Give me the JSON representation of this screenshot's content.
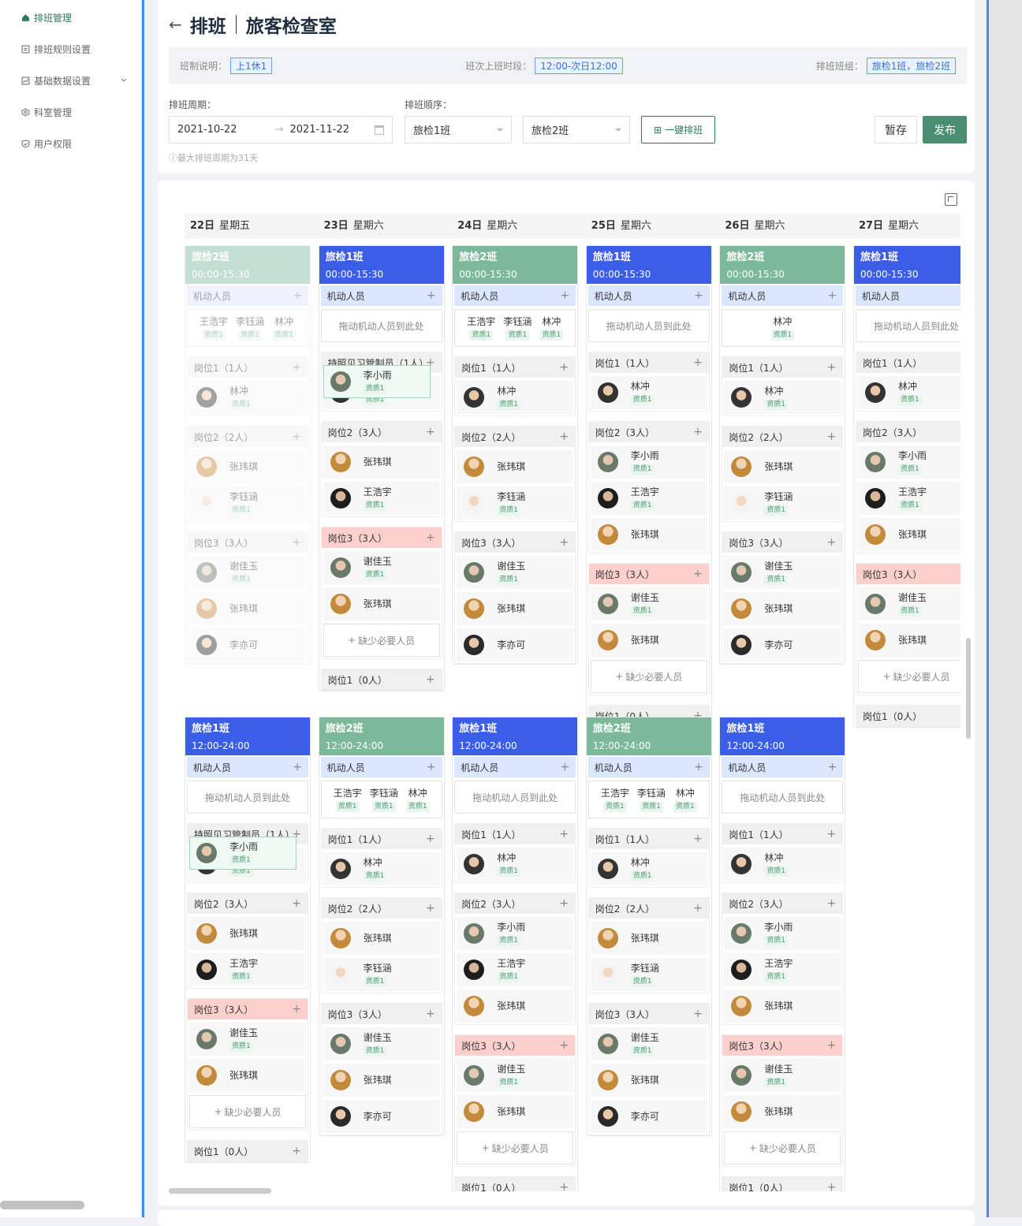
{
  "sidebar": {
    "items": [
      {
        "label": "排班管理",
        "icon": "home-icon",
        "active": true
      },
      {
        "label": "排班规则设置",
        "icon": "document-icon"
      },
      {
        "label": "基础数据设置",
        "icon": "chart-icon",
        "chevron": true
      },
      {
        "label": "科室管理",
        "icon": "settings-icon"
      },
      {
        "label": "用户权限",
        "icon": "shield-icon"
      }
    ]
  },
  "header": {
    "back_icon": "←",
    "title": "排班",
    "subtitle": "旅客检查室",
    "info": {
      "system_label": "班制说明：",
      "system_value": "上1休1",
      "period_label": "班次上班时段：",
      "period_value": "12:00-次日12:00",
      "group_label": "排班班组：",
      "group_value": "旅检1班，旅检2班"
    },
    "cycle_label": "排班周期：",
    "start_date": "2021-10-22",
    "end_date": "2021-11-22",
    "order_label": "排班顺序：",
    "order1": "旅检1班",
    "order2": "旅检2班",
    "auto_button": "一键排班",
    "save_button": "暂存",
    "publish_button": "发布",
    "tip": "最大排班周期为31天"
  },
  "days": [
    {
      "date": "22日",
      "weekday": "星期五"
    },
    {
      "date": "23日",
      "weekday": "星期六"
    },
    {
      "date": "24日",
      "weekday": "星期六"
    },
    {
      "date": "25日",
      "weekday": "星期六"
    },
    {
      "date": "26日",
      "weekday": "星期六"
    },
    {
      "date": "27日",
      "weekday": "星期六"
    }
  ],
  "labels": {
    "mobile": "机动人员",
    "drop": "拖动机动人员到此处",
    "missing": "缺少必要人员",
    "qual": "资质1"
  },
  "row1": [
    {
      "name": "旅检2班",
      "time": "00:00-15:30",
      "color": "green",
      "faded": true,
      "mobile": [
        "王浩宇",
        "李钰涵",
        "林冲"
      ],
      "posts": [
        {
          "title": "岗位1（1人）",
          "people": [
            [
              "林冲",
              "a1",
              true
            ]
          ]
        },
        {
          "title": "岗位2（2人）",
          "people": [
            [
              "张玮琪",
              "a2",
              false
            ],
            [
              "李钰涵",
              "a4",
              true
            ]
          ]
        },
        {
          "title": "岗位3（3人）",
          "people": [
            [
              "谢佳玉",
              "a3",
              true
            ],
            [
              "张玮琪",
              "a2",
              false
            ],
            [
              "李亦可",
              "a6",
              false
            ]
          ]
        }
      ]
    },
    {
      "name": "旅检1班",
      "time": "00:00-15:30",
      "color": "blue",
      "mobile": [],
      "posts": [
        {
          "title": "持照见习管制员（1人）",
          "people": [
            [
              "林冲",
              "a1",
              true
            ]
          ]
        },
        {
          "title": "岗位2（3人）",
          "people": [
            [
              "李小雨",
              "a3",
              true,
              "sel"
            ],
            [
              "张玮琪",
              "a2",
              false
            ],
            [
              "王浩宇",
              "a5",
              true
            ]
          ]
        },
        {
          "title": "岗位3（3人）",
          "red": true,
          "people": [
            [
              "谢佳玉",
              "a3",
              true
            ],
            [
              "张玮琪",
              "a2",
              false
            ]
          ],
          "missing": true
        },
        {
          "title": "岗位1（0人）",
          "people": []
        }
      ]
    },
    {
      "name": "旅检2班",
      "time": "00:00-15:30",
      "color": "green",
      "mobile": [
        "王浩宇",
        "李钰涵",
        "林冲"
      ],
      "posts": [
        {
          "title": "岗位1（1人）",
          "people": [
            [
              "林冲",
              "a1",
              true
            ]
          ]
        },
        {
          "title": "岗位2（2人）",
          "people": [
            [
              "张玮琪",
              "a2",
              false
            ],
            [
              "李钰涵",
              "a4",
              true
            ]
          ]
        },
        {
          "title": "岗位3（3人）",
          "people": [
            [
              "谢佳玉",
              "a3",
              true
            ],
            [
              "张玮琪",
              "a2",
              false
            ],
            [
              "李亦可",
              "a6",
              false
            ]
          ]
        }
      ]
    },
    {
      "name": "旅检1班",
      "time": "00:00-15:30",
      "color": "blue",
      "mobile": [],
      "posts": [
        {
          "title": "岗位1（1人）",
          "people": [
            [
              "林冲",
              "a1",
              true
            ]
          ]
        },
        {
          "title": "岗位2（3人）",
          "people": [
            [
              "李小雨",
              "a3",
              true
            ],
            [
              "王浩宇",
              "a5",
              true
            ],
            [
              "张玮琪",
              "a2",
              false
            ]
          ]
        },
        {
          "title": "岗位3（3人）",
          "red": true,
          "people": [
            [
              "谢佳玉",
              "a3",
              true
            ],
            [
              "张玮琪",
              "a2",
              false
            ]
          ],
          "missing": true
        },
        {
          "title": "岗位1（0人）",
          "people": []
        }
      ]
    },
    {
      "name": "旅检2班",
      "time": "00:00-15:30",
      "color": "green",
      "mobile": [
        "林冲"
      ],
      "posts": [
        {
          "title": "岗位1（1人）",
          "people": [
            [
              "林冲",
              "a1",
              true
            ]
          ]
        },
        {
          "title": "岗位2（2人）",
          "people": [
            [
              "张玮琪",
              "a2",
              false
            ],
            [
              "李钰涵",
              "a4",
              true
            ]
          ]
        },
        {
          "title": "岗位3（3人）",
          "people": [
            [
              "谢佳玉",
              "a3",
              true
            ],
            [
              "张玮琪",
              "a2",
              false
            ],
            [
              "李亦可",
              "a6",
              false
            ]
          ]
        }
      ]
    },
    {
      "name": "旅检1班",
      "time": "00:00-15:30",
      "color": "blue",
      "mobile": [],
      "posts": [
        {
          "title": "岗位1（1人）",
          "people": [
            [
              "林冲",
              "a1",
              true
            ]
          ]
        },
        {
          "title": "岗位2（3人）",
          "people": [
            [
              "李小雨",
              "a3",
              true
            ],
            [
              "王浩宇",
              "a5",
              true
            ],
            [
              "张玮琪",
              "a2",
              false
            ]
          ]
        },
        {
          "title": "岗位3（3人）",
          "red": true,
          "people": [
            [
              "谢佳玉",
              "a3",
              true
            ],
            [
              "张玮琪",
              "a2",
              false
            ]
          ],
          "missing": true
        },
        {
          "title": "岗位1（0人）",
          "people": []
        }
      ]
    }
  ],
  "row2": [
    {
      "name": "旅检1班",
      "time": "12:00-24:00",
      "color": "blue",
      "mobile": [],
      "posts": [
        {
          "title": "持照见习管制员（1人）",
          "people": [
            [
              "林冲",
              "a1",
              true
            ]
          ]
        },
        {
          "title": "岗位2（3人）",
          "people": [
            [
              "李小雨",
              "a3",
              true,
              "sel"
            ],
            [
              "张玮琪",
              "a2",
              false
            ],
            [
              "王浩宇",
              "a5",
              true
            ]
          ]
        },
        {
          "title": "岗位3（3人）",
          "red": true,
          "people": [
            [
              "谢佳玉",
              "a3",
              true
            ],
            [
              "张玮琪",
              "a2",
              false
            ]
          ],
          "missing": true
        },
        {
          "title": "岗位1（0人）",
          "people": []
        }
      ]
    },
    {
      "name": "旅检2班",
      "time": "12:00-24:00",
      "color": "green",
      "mobile": [
        "王浩宇",
        "李钰涵",
        "林冲"
      ],
      "posts": [
        {
          "title": "岗位1（1人）",
          "people": [
            [
              "林冲",
              "a1",
              true
            ]
          ]
        },
        {
          "title": "岗位2（2人）",
          "people": [
            [
              "张玮琪",
              "a2",
              false
            ],
            [
              "李钰涵",
              "a4",
              true
            ]
          ]
        },
        {
          "title": "岗位3（3人）",
          "people": [
            [
              "谢佳玉",
              "a3",
              true
            ],
            [
              "张玮琪",
              "a2",
              false
            ],
            [
              "李亦可",
              "a6",
              false
            ]
          ]
        }
      ]
    },
    {
      "name": "旅检1班",
      "time": "12:00-24:00",
      "color": "blue",
      "mobile": [],
      "posts": [
        {
          "title": "岗位1（1人）",
          "people": [
            [
              "林冲",
              "a1",
              true
            ]
          ]
        },
        {
          "title": "岗位2（3人）",
          "people": [
            [
              "李小雨",
              "a3",
              true
            ],
            [
              "王浩宇",
              "a5",
              true
            ],
            [
              "张玮琪",
              "a2",
              false
            ]
          ]
        },
        {
          "title": "岗位3（3人）",
          "red": true,
          "people": [
            [
              "谢佳玉",
              "a3",
              true
            ],
            [
              "张玮琪",
              "a2",
              false
            ]
          ],
          "missing": true
        },
        {
          "title": "岗位1（0人）",
          "people": []
        }
      ]
    },
    {
      "name": "旅检2班",
      "time": "12:00-24:00",
      "color": "green",
      "mobile": [
        "王浩宇",
        "李钰涵",
        "林冲"
      ],
      "posts": [
        {
          "title": "岗位1（1人）",
          "people": [
            [
              "林冲",
              "a1",
              true
            ]
          ]
        },
        {
          "title": "岗位2（2人）",
          "people": [
            [
              "张玮琪",
              "a2",
              false
            ],
            [
              "李钰涵",
              "a4",
              true
            ]
          ]
        },
        {
          "title": "岗位3（3人）",
          "people": [
            [
              "谢佳玉",
              "a3",
              true
            ],
            [
              "张玮琪",
              "a2",
              false
            ],
            [
              "李亦可",
              "a6",
              false
            ]
          ]
        }
      ]
    },
    {
      "name": "旅检1班",
      "time": "12:00-24:00",
      "color": "blue",
      "mobile": [],
      "posts": [
        {
          "title": "岗位1（1人）",
          "people": [
            [
              "林冲",
              "a1",
              true
            ]
          ]
        },
        {
          "title": "岗位2（3人）",
          "people": [
            [
              "李小雨",
              "a3",
              true
            ],
            [
              "王浩宇",
              "a5",
              true
            ],
            [
              "张玮琪",
              "a2",
              false
            ]
          ]
        },
        {
          "title": "岗位3（3人）",
          "red": true,
          "people": [
            [
              "谢佳玉",
              "a3",
              true
            ],
            [
              "张玮琪",
              "a2",
              false
            ]
          ],
          "missing": true
        },
        {
          "title": "岗位1（0人）",
          "people": []
        }
      ]
    }
  ]
}
